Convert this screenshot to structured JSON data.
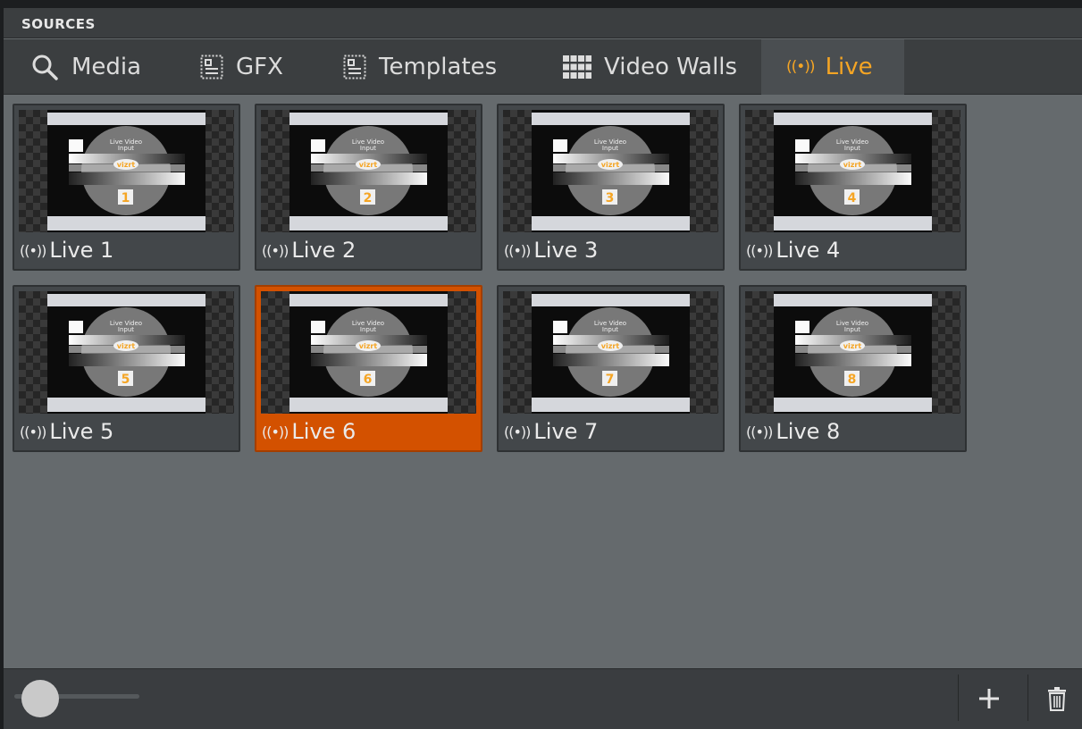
{
  "header": {
    "title": "SOURCES"
  },
  "tabs": [
    {
      "label": "Media",
      "icon": "search-icon"
    },
    {
      "label": "GFX",
      "icon": "gfx-icon"
    },
    {
      "label": "Templates",
      "icon": "templates-icon"
    },
    {
      "label": "Video Walls",
      "icon": "video-wall-icon"
    },
    {
      "label": "Live",
      "icon": "live-icon",
      "active": true
    }
  ],
  "sources": [
    {
      "label": "Live 1",
      "number": "1"
    },
    {
      "label": "Live 2",
      "number": "2"
    },
    {
      "label": "Live 3",
      "number": "3"
    },
    {
      "label": "Live 4",
      "number": "4"
    },
    {
      "label": "Live 5",
      "number": "5"
    },
    {
      "label": "Live 6",
      "number": "6",
      "selected": true
    },
    {
      "label": "Live 7",
      "number": "7"
    },
    {
      "label": "Live 8",
      "number": "8"
    }
  ],
  "thumbnail": {
    "caption_line1": "Live Video",
    "caption_line2": "Input",
    "logo": "vizrt"
  },
  "live_glyph": "((•))",
  "colors": {
    "accent": "#f5a524",
    "selected": "#d35100",
    "panel": "#656a6d",
    "bar": "#3b3e40"
  },
  "footer": {
    "zoom_level": 0.1,
    "add_icon": "plus-icon",
    "delete_icon": "trash-icon"
  }
}
